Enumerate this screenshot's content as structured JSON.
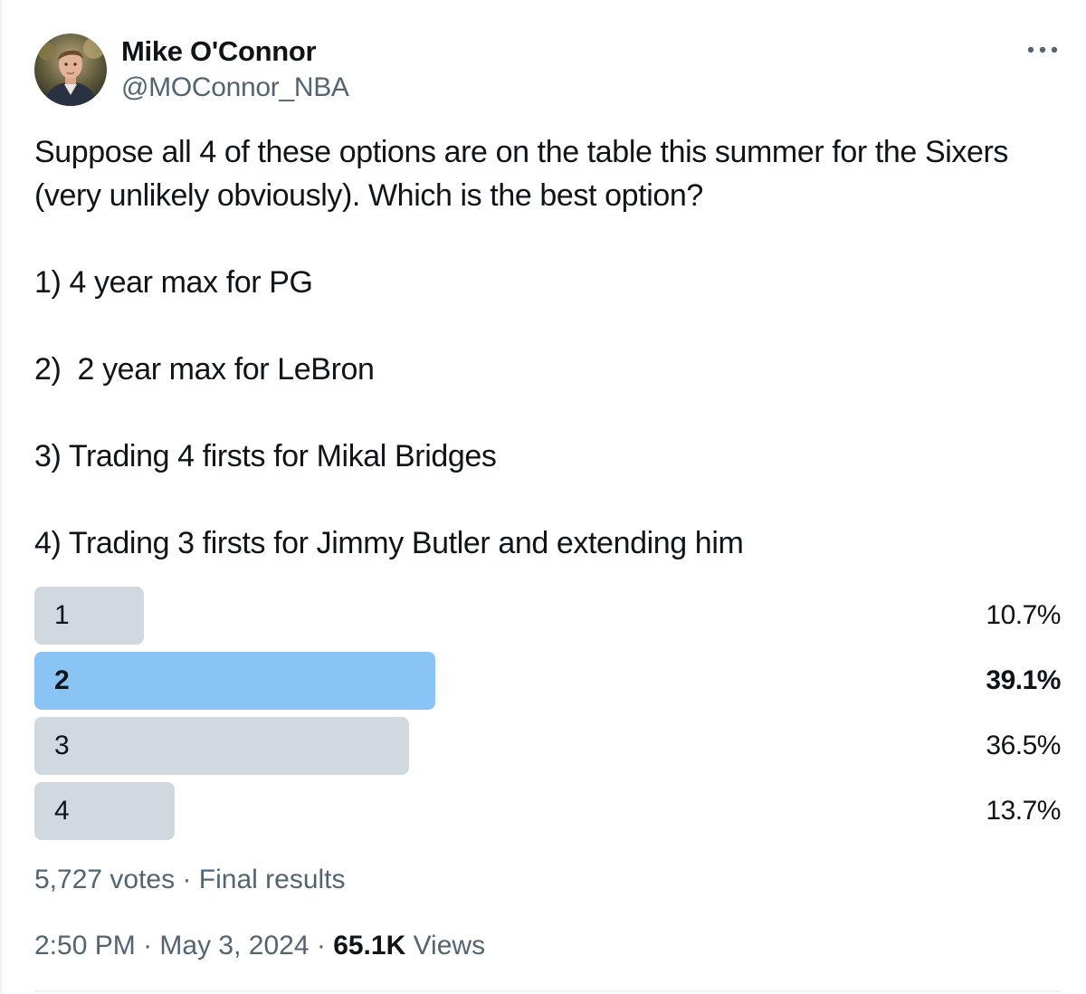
{
  "author": {
    "display_name": "Mike O'Connor",
    "handle": "@MOConnor_NBA"
  },
  "more_icon": "more-horizontal-icon",
  "tweet_text": "Suppose all 4 of these options are on the table this summer for the Sixers (very unlikely obviously). Which is the best option?\n\n1) 4 year max for PG\n\n2)  2 year max for LeBron\n\n3) Trading 4 firsts for Mikal Bridges\n\n4) Trading 3 firsts for Jimmy Butler and extending him",
  "poll": {
    "options": [
      {
        "label": "1",
        "percent_text": "10.7%",
        "percent": 10.7,
        "winner": false
      },
      {
        "label": "2",
        "percent_text": "39.1%",
        "percent": 39.1,
        "winner": true
      },
      {
        "label": "3",
        "percent_text": "36.5%",
        "percent": 36.5,
        "winner": false
      },
      {
        "label": "4",
        "percent_text": "13.7%",
        "percent": 13.7,
        "winner": false
      }
    ],
    "votes": "5,727 votes",
    "separator": " · ",
    "status": "Final results"
  },
  "meta": {
    "time": "2:50 PM",
    "separator": " · ",
    "date": "May 3, 2024",
    "views_count": "65.1K",
    "views_label": " Views"
  },
  "colors": {
    "bar_default": "#cfd9de",
    "bar_winner": "#8ac4f5",
    "secondary_text": "#536471",
    "primary_text": "#0f1419"
  }
}
